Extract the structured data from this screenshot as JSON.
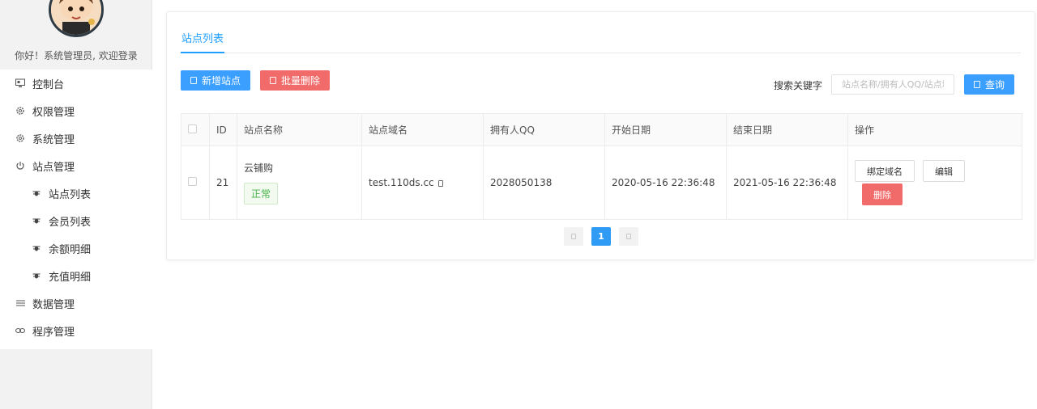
{
  "sidebar": {
    "greeting": "你好！系统管理员, 欢迎登录",
    "items": [
      {
        "label": "控制台",
        "icon": "monitor-icon"
      },
      {
        "label": "权限管理",
        "icon": "gear-icon"
      },
      {
        "label": "系统管理",
        "icon": "gear-icon"
      },
      {
        "label": "站点管理",
        "icon": "power-icon"
      },
      {
        "label": "站点列表",
        "icon": "bug-icon"
      },
      {
        "label": "会员列表",
        "icon": "bug-icon"
      },
      {
        "label": "余额明细",
        "icon": "bug-icon"
      },
      {
        "label": "充值明细",
        "icon": "bug-icon"
      },
      {
        "label": "数据管理",
        "icon": "list-icon"
      },
      {
        "label": "程序管理",
        "icon": "link-icon"
      }
    ]
  },
  "main": {
    "tab_label": "站点列表",
    "add_button": "新增站点",
    "batch_delete_button": "批量删除",
    "search_label": "搜索关键字",
    "search_placeholder": "站点名称/拥有人QQ/站点域名",
    "query_button": "查询",
    "table": {
      "headers": [
        "ID",
        "站点名称",
        "站点域名",
        "拥有人QQ",
        "开始日期",
        "结束日期",
        "操作"
      ],
      "rows": [
        {
          "id": "21",
          "name": "云铺购",
          "status": "正常",
          "domain": "test.110ds.cc",
          "owner_qq": "2028050138",
          "start_date": "2020-05-16 22:36:48",
          "end_date": "2021-05-16 22:36:48",
          "bind_domain": "绑定域名",
          "edit": "编辑",
          "delete": "删除"
        }
      ]
    },
    "pagination": {
      "current_page": "1"
    }
  },
  "colors": {
    "accent": "#1e9fff",
    "danger": "#f26b6b",
    "success": "#47b34a"
  }
}
